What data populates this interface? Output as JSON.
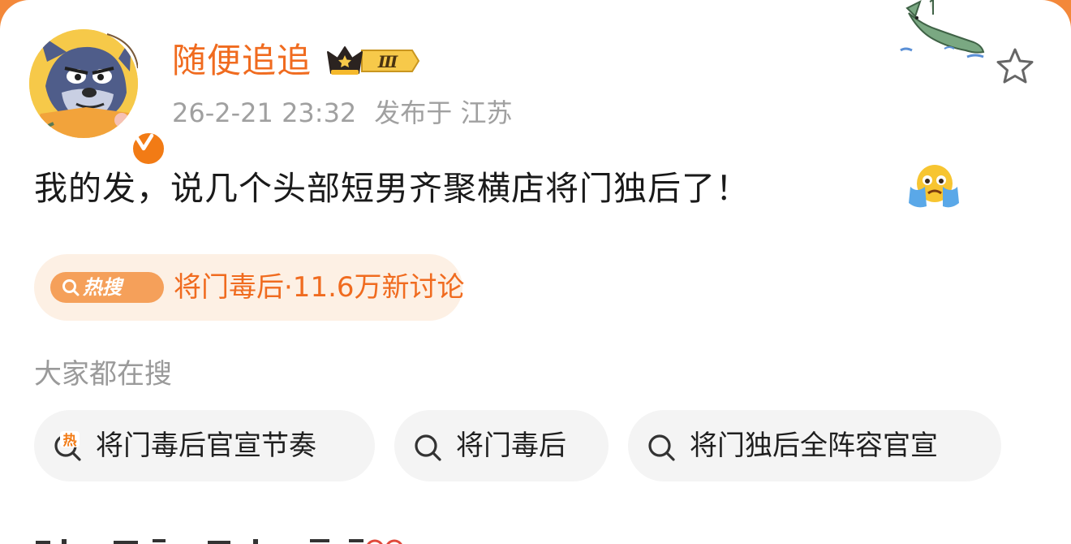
{
  "post": {
    "username": "随便追追",
    "vip_level": "Ⅲ",
    "time": "26-2-21 23:32",
    "location_prefix": "发布于",
    "location": "江苏",
    "text": "我的发，说几个头部短男齐聚横店将门独后了！",
    "emoji": "crying-face-emoji"
  },
  "hot_search": {
    "badge": "热搜",
    "text": "将门毒后·11.6万新讨论"
  },
  "related": {
    "title": "大家都在搜",
    "chips": [
      {
        "label": "将门毒后官宣节奏",
        "icon": "hot-search-icon",
        "hot_mark": "热"
      },
      {
        "label": "将门毒后",
        "icon": "search-icon"
      },
      {
        "label": "将门独后全阵容官宣",
        "icon": "search-icon"
      }
    ]
  },
  "colors": {
    "background": "#f3883a",
    "username": "#f06b1f",
    "hot_pill_bg": "#fdf0e4",
    "chip_bg": "#f4f4f4"
  }
}
